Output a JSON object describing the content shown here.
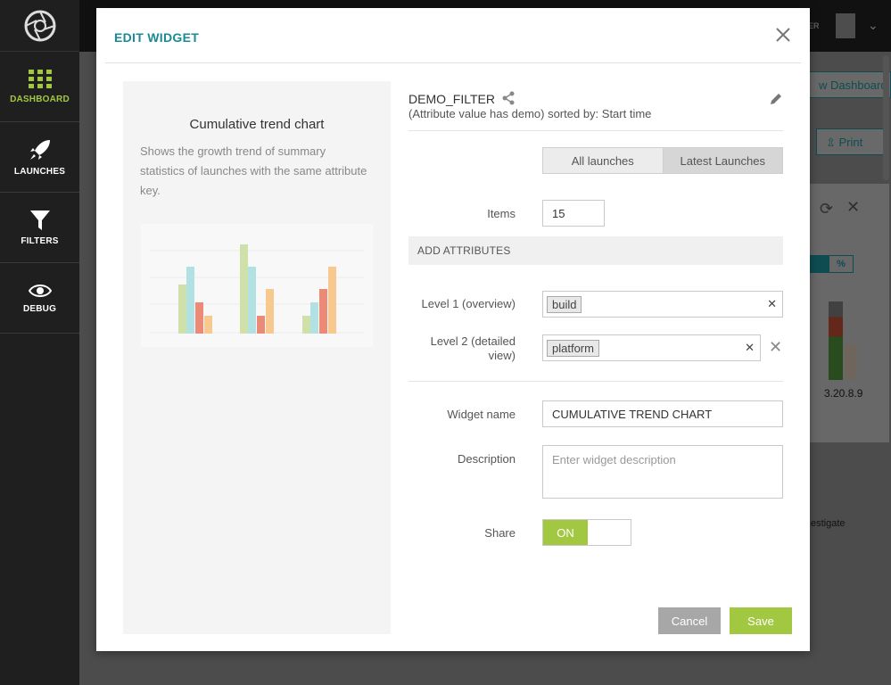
{
  "sidebar": {
    "logo": "aperture-logo",
    "items": [
      {
        "label": "DASHBOARD",
        "icon": "grid-icon"
      },
      {
        "label": "LAUNCHES",
        "icon": "rocket-icon"
      },
      {
        "label": "FILTERS",
        "icon": "funnel-icon"
      },
      {
        "label": "DEBUG",
        "icon": "eye-icon"
      }
    ]
  },
  "background": {
    "user_fragment": "GER",
    "view_dashboard": "w Dashboard",
    "print": "Print",
    "percent": "%",
    "version": "3.20.8.9",
    "investigate": "estigate"
  },
  "modal": {
    "title": "EDIT WIDGET",
    "preview": {
      "title": "Cumulative trend chart",
      "description": "Shows the growth trend of summary statistics of launches with the same attribute key."
    },
    "filter": {
      "name": "DEMO_FILTER",
      "description": "(Attribute value has demo) sorted by: Start time"
    },
    "mode_toggle": {
      "options": [
        "All launches",
        "Latest Launches"
      ],
      "selected": "Latest Launches"
    },
    "items": {
      "label": "Items",
      "value": "15"
    },
    "attributes": {
      "section_label": "ADD ATTRIBUTES",
      "level1": {
        "label": "Level 1 (overview)",
        "tag": "build"
      },
      "level2": {
        "label": "Level 2 (detailed view)",
        "tag": "platform"
      }
    },
    "widget_name": {
      "label": "Widget name",
      "value": "CUMULATIVE TREND CHART"
    },
    "description": {
      "label": "Description",
      "placeholder": "Enter widget description"
    },
    "share": {
      "label": "Share",
      "state": "ON"
    },
    "buttons": {
      "cancel": "Cancel",
      "save": "Save"
    }
  },
  "colors": {
    "accent": "#a2c741",
    "teal": "#1a8a95"
  }
}
